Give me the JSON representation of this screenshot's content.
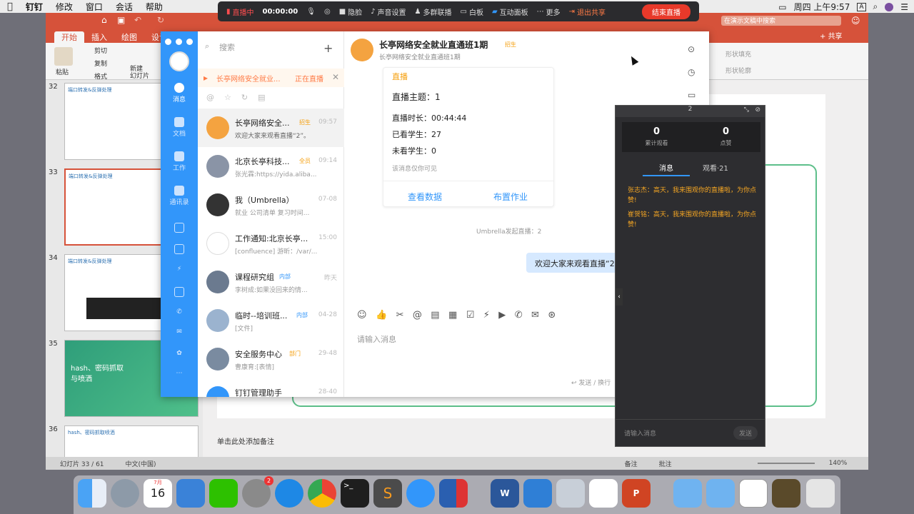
{
  "menubar": {
    "app": "钉钉",
    "items": [
      "修改",
      "窗口",
      "会话",
      "帮助"
    ],
    "clock": "周四 上午9:57",
    "input_method": "A"
  },
  "livebar": {
    "status": "直播中",
    "time": "00:00:00",
    "items": [
      "隐脸",
      "声音设置",
      "多群联播",
      "白板",
      "互动面板",
      "更多"
    ],
    "exit_share": "退出共享",
    "end_live": "结束直播"
  },
  "ppt": {
    "tabs": [
      "开始",
      "插入",
      "绘图",
      "设计"
    ],
    "ribbon": {
      "paste": "粘贴",
      "cut": "剪切",
      "copy": "复制",
      "format": "格式",
      "new_slide": "新建\n幻灯片",
      "shape_fill": "形状填充",
      "shape_outline": "形状轮廓"
    },
    "search_placeholder": "在演示文稿中搜索",
    "share": "共享",
    "thumbs": [
      {
        "num": "32",
        "title": "端口转发&反弹处理"
      },
      {
        "num": "33",
        "title": "端口转发&反弹处理"
      },
      {
        "num": "34",
        "title": "端口转发&反弹处理"
      },
      {
        "num": "35",
        "title": "hash、密码抓取\n与喷洒"
      },
      {
        "num": "36",
        "title": "hash、密码抓取喷洒"
      }
    ],
    "notes": "单击此处添加备注",
    "status": {
      "slide": "幻灯片 33 / 61",
      "lang": "中文(中国)",
      "notes": "备注",
      "comments": "批注",
      "zoom": "140%"
    }
  },
  "dingtalk": {
    "sidebar": [
      "消息",
      "文档",
      "工作",
      "通讯录"
    ],
    "search_placeholder": "搜索",
    "live_banner": "长亭网络安全就业...",
    "live_banner_status": "正在直播",
    "conversations": [
      {
        "name": "长亭网络安全...",
        "tag": "招生",
        "msg": "欢迎大家来观看直播“2”。",
        "time": "09:57"
      },
      {
        "name": "北京长亭科技...",
        "tag": "全员",
        "msg": "张光霖:https://yida.aliba...",
        "time": "09:14"
      },
      {
        "name": "我（Umbrella）",
        "tag": "",
        "msg": "就业  公司清单  复习时间...",
        "time": "07-08"
      },
      {
        "name": "工作通知:北京长亭...",
        "tag": "",
        "msg": "[confluence] 游昕：/var/...",
        "time": "15:00"
      },
      {
        "name": "课程研究组",
        "tag": "内部",
        "msg": "李树成:如果没回来的情...",
        "time": "昨天"
      },
      {
        "name": "临时--培训班...",
        "tag": "内部",
        "msg": "[文件]",
        "time": "04-28"
      },
      {
        "name": "安全服务中心",
        "tag": "部门",
        "msg": "曹康育:[表情]",
        "time": "29-48"
      },
      {
        "name": "钉钉管理助手",
        "tag": "",
        "msg": "",
        "time": "28-40"
      }
    ],
    "chat": {
      "title": "长亭网络安全就业直通班1期",
      "title_tag": "招生",
      "subtitle": "长亭网络安全就业直通班1期",
      "card": {
        "label": "直播",
        "topic": "直播主题：1",
        "duration": "直播时长：00:44:44",
        "watched": "已看学生：27",
        "unwatched": "未看学生：0",
        "visible_note": "该消息仅你可见",
        "btn_data": "查看数据",
        "btn_homework": "布置作业"
      },
      "system_msg": "Umbrella发起直播：2",
      "bubble": "欢迎大家来观看直播“2",
      "input_placeholder": "请输入消息",
      "send_hint": "↩ 发送 / 换行"
    }
  },
  "live_panel": {
    "title": "2",
    "total_views": "0",
    "total_views_label": "累计观看",
    "likes": "0",
    "likes_label": "点赞",
    "tab_msg": "消息",
    "tab_viewers": "观看·21",
    "messages": [
      "张志杰：高天，我来围观你的直播啦，为你点赞!",
      "崔贺铭：高天，我来围观你的直播啦，为你点赞!"
    ],
    "input_placeholder": "请输入消息",
    "send": "发送"
  },
  "dock": {
    "calendar_day": "16",
    "calendar_month": "7月",
    "badge": "2"
  }
}
